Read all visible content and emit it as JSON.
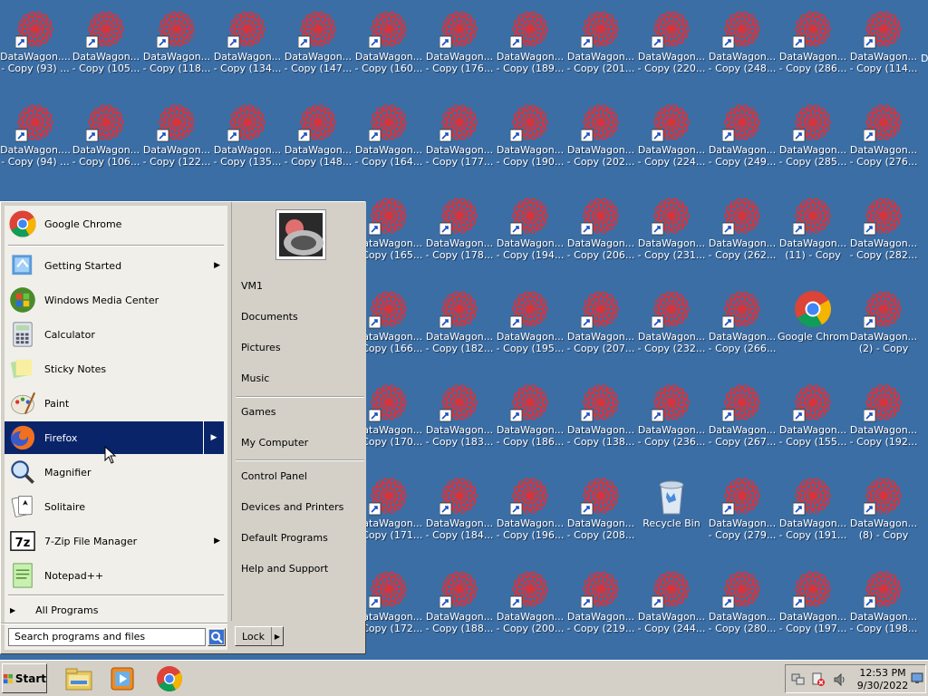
{
  "desktop": {
    "rows": [
      [
        {
          "l1": "DataWagon....",
          "l2": "- Copy (93) ..."
        },
        {
          "l1": "DataWagon...",
          "l2": "- Copy (105..."
        },
        {
          "l1": "DataWagon...",
          "l2": "- Copy (118..."
        },
        {
          "l1": "DataWagon...",
          "l2": "- Copy (134..."
        },
        {
          "l1": "DataWagon...",
          "l2": "- Copy (147..."
        },
        {
          "l1": "DataWagon...",
          "l2": "- Copy (160..."
        },
        {
          "l1": "DataWagon...",
          "l2": "- Copy (176..."
        },
        {
          "l1": "DataWagon...",
          "l2": "- Copy (189..."
        },
        {
          "l1": "DataWagon...",
          "l2": "- Copy (201..."
        },
        {
          "l1": "DataWagon...",
          "l2": "- Copy (220..."
        },
        {
          "l1": "DataWagon...",
          "l2": "- Copy (248..."
        },
        {
          "l1": "DataWagon...",
          "l2": "- Copy (286..."
        },
        {
          "l1": "DataWagon...",
          "l2": "- Copy (114..."
        }
      ],
      [
        {
          "l1": "DataWagon....",
          "l2": "- Copy (94) ..."
        },
        {
          "l1": "DataWagon...",
          "l2": "- Copy (106..."
        },
        {
          "l1": "DataWagon...",
          "l2": "- Copy (122..."
        },
        {
          "l1": "DataWagon...",
          "l2": "- Copy (135..."
        },
        {
          "l1": "DataWagon...",
          "l2": "- Copy (148..."
        },
        {
          "l1": "DataWagon...",
          "l2": "- Copy (164..."
        },
        {
          "l1": "DataWagon...",
          "l2": "- Copy (177..."
        },
        {
          "l1": "DataWagon...",
          "l2": "- Copy (190..."
        },
        {
          "l1": "DataWagon...",
          "l2": "- Copy (202..."
        },
        {
          "l1": "DataWagon...",
          "l2": "- Copy (224..."
        },
        {
          "l1": "DataWagon...",
          "l2": "- Copy (249..."
        },
        {
          "l1": "DataWagon...",
          "l2": "- Copy (285..."
        },
        {
          "l1": "DataWagon...",
          "l2": "- Copy (276..."
        }
      ],
      [
        {
          "l1": "DataWagon...",
          "l2": "- Copy (165..."
        },
        {
          "l1": "DataWagon...",
          "l2": "- Copy (178..."
        },
        {
          "l1": "DataWagon...",
          "l2": "- Copy (194..."
        },
        {
          "l1": "DataWagon...",
          "l2": "- Copy (206..."
        },
        {
          "l1": "DataWagon...",
          "l2": "- Copy (231..."
        },
        {
          "l1": "DataWagon...",
          "l2": "- Copy (262..."
        },
        {
          "l1": "DataWagon...",
          "l2": "(11) - Copy"
        },
        {
          "l1": "DataWagon...",
          "l2": "- Copy (282..."
        }
      ],
      [
        {
          "l1": "DataWagon...",
          "l2": "- Copy (166..."
        },
        {
          "l1": "DataWagon...",
          "l2": "- Copy (182..."
        },
        {
          "l1": "DataWagon...",
          "l2": "- Copy (195..."
        },
        {
          "l1": "DataWagon...",
          "l2": "- Copy (207..."
        },
        {
          "l1": "DataWagon...",
          "l2": "- Copy (232..."
        },
        {
          "l1": "DataWagon...",
          "l2": "- Copy (266..."
        },
        {
          "l1": "Google Chrome",
          "l2": "",
          "kind": "chrome"
        },
        {
          "l1": "DataWagon...",
          "l2": "(2) - Copy"
        }
      ],
      [
        {
          "l1": "DataWagon...",
          "l2": "- Copy (170..."
        },
        {
          "l1": "DataWagon...",
          "l2": "- Copy (183..."
        },
        {
          "l1": "DataWagon...",
          "l2": "- Copy (186..."
        },
        {
          "l1": "DataWagon...",
          "l2": "- Copy (138..."
        },
        {
          "l1": "DataWagon...",
          "l2": "- Copy (236..."
        },
        {
          "l1": "DataWagon...",
          "l2": "- Copy (267..."
        },
        {
          "l1": "DataWagon...",
          "l2": "- Copy (155..."
        },
        {
          "l1": "DataWagon...",
          "l2": "- Copy (192..."
        }
      ],
      [
        {
          "l1": "DataWagon...",
          "l2": "- Copy (171..."
        },
        {
          "l1": "DataWagon...",
          "l2": "- Copy (184..."
        },
        {
          "l1": "DataWagon...",
          "l2": "- Copy (196..."
        },
        {
          "l1": "DataWagon...",
          "l2": "- Copy (208..."
        },
        {
          "l1": "Recycle Bin",
          "l2": "",
          "kind": "bin"
        },
        {
          "l1": "DataWagon...",
          "l2": "- Copy (279..."
        },
        {
          "l1": "DataWagon...",
          "l2": "- Copy (191..."
        },
        {
          "l1": "DataWagon...",
          "l2": "(8) - Copy"
        }
      ],
      [
        {
          "l1": "DataWagon...",
          "l2": "- Copy (172..."
        },
        {
          "l1": "DataWagon...",
          "l2": "- Copy (188..."
        },
        {
          "l1": "DataWagon...",
          "l2": "- Copy (200..."
        },
        {
          "l1": "DataWagon...",
          "l2": "- Copy (219..."
        },
        {
          "l1": "DataWagon...",
          "l2": "- Copy (244..."
        },
        {
          "l1": "DataWagon...",
          "l2": "- Copy (280..."
        },
        {
          "l1": "DataWagon...",
          "l2": "- Copy (197..."
        },
        {
          "l1": "DataWagon...",
          "l2": "- Copy (198..."
        }
      ]
    ]
  },
  "start_menu": {
    "pinned": {
      "label": "Google Chrome",
      "icon": "chrome-icon"
    },
    "programs": [
      {
        "label": "Getting Started",
        "icon": "getting-started-icon",
        "submenu": true
      },
      {
        "label": "Windows Media Center",
        "icon": "media-center-icon"
      },
      {
        "label": "Calculator",
        "icon": "calculator-icon"
      },
      {
        "label": "Sticky Notes",
        "icon": "sticky-notes-icon"
      },
      {
        "label": "Paint",
        "icon": "paint-icon"
      },
      {
        "label": "Firefox",
        "icon": "firefox-icon",
        "submenu": true,
        "selected": true
      },
      {
        "label": "Magnifier",
        "icon": "magnifier-icon"
      },
      {
        "label": "Solitaire",
        "icon": "solitaire-icon"
      },
      {
        "label": "7-Zip File Manager",
        "icon": "7zip-icon",
        "submenu": true
      },
      {
        "label": "Notepad++",
        "icon": "notepadpp-icon"
      }
    ],
    "all_programs": "All Programs",
    "search_placeholder": "Search programs and files",
    "right": {
      "user": "VM1",
      "group1": [
        "Documents",
        "Pictures",
        "Music"
      ],
      "group2": [
        "Games",
        "My Computer"
      ],
      "group3": [
        "Control Panel",
        "Devices and Printers",
        "Default Programs",
        "Help and Support"
      ]
    },
    "lock_label": "Lock"
  },
  "taskbar": {
    "start_label": "Start",
    "clock_time": "12:53 PM",
    "clock_date": "9/30/2022",
    "apps": [
      "explorer-icon",
      "media-player-icon",
      "chrome-icon"
    ]
  },
  "colors": {
    "desktop": "#3a6ea5",
    "selection": "#0a246a",
    "menu": "#d4d0c8",
    "menu_left": "#f0efe9"
  }
}
